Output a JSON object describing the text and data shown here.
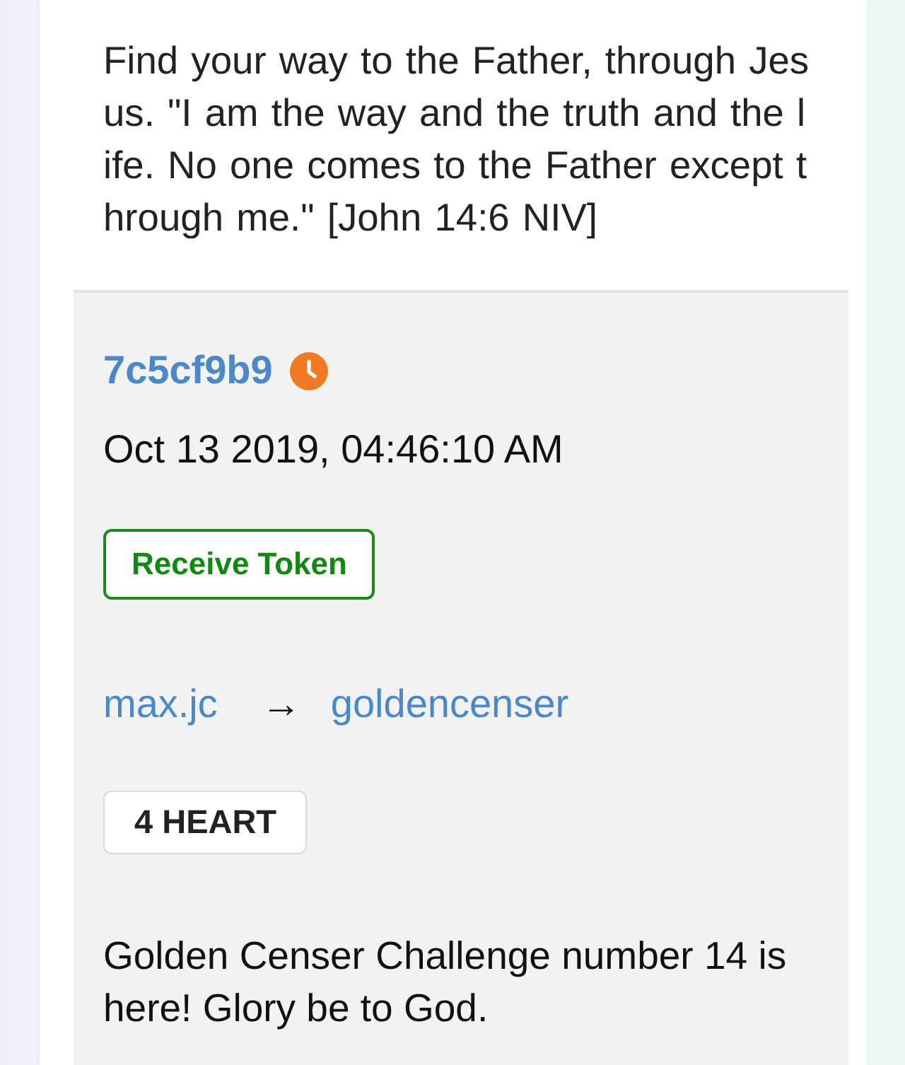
{
  "post": {
    "text": "Find your way to the Father, through Jesus. \"I am the way and the truth and the life. No one comes to the Father except through me.\" [John 14:6 NIV]"
  },
  "transaction": {
    "id": "7c5cf9b9",
    "timestamp": "Oct 13 2019, 04:46:10 AM",
    "action": {
      "label": "Receive Token",
      "kind": "receive"
    },
    "from": "max.jc",
    "arrow": "→",
    "to": "goldencenser",
    "amount": "4 HEART",
    "memo": "Golden Censer Challenge number 14 is here! Glory be to God."
  }
}
